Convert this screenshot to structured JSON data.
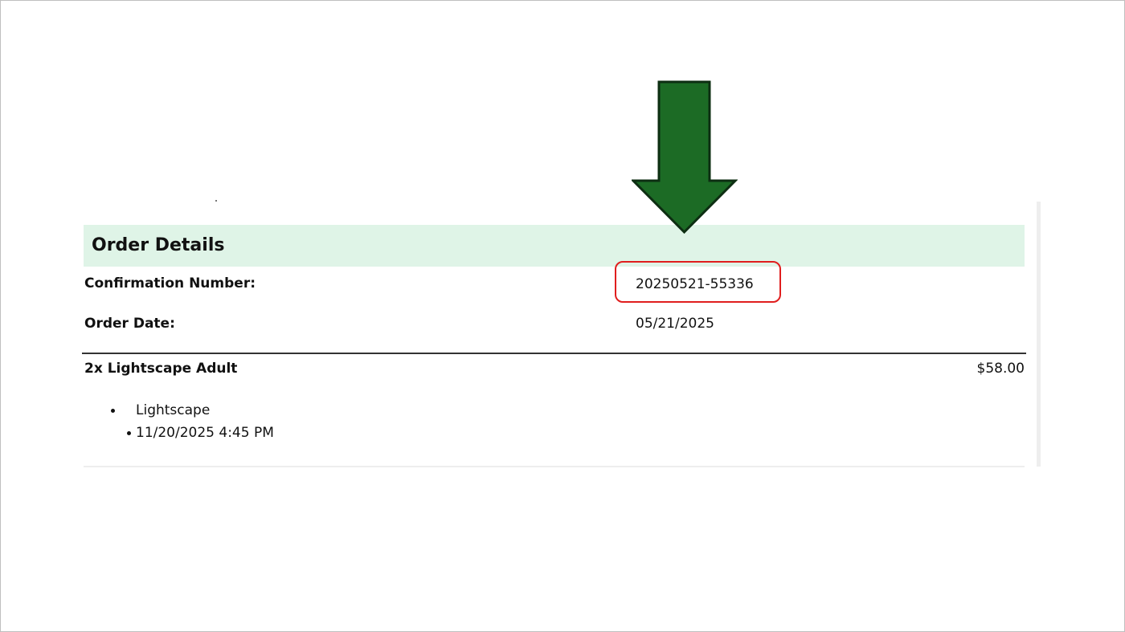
{
  "colors": {
    "header_background": "#dff4e7",
    "arrow_fill": "#1c6b25",
    "highlight_border": "#e01e1e"
  },
  "icons": {
    "pointer": "down-arrow-icon"
  },
  "order": {
    "title": "Order Details",
    "confirmation": {
      "label": "Confirmation Number:",
      "value": "20250521-55336"
    },
    "date": {
      "label": "Order Date:",
      "value": "05/21/2025"
    },
    "item": {
      "name": "2x Lightscape Adult",
      "price": "$58.00",
      "venue": "Lightscape",
      "datetime": "11/20/2025 4:45 PM"
    }
  }
}
